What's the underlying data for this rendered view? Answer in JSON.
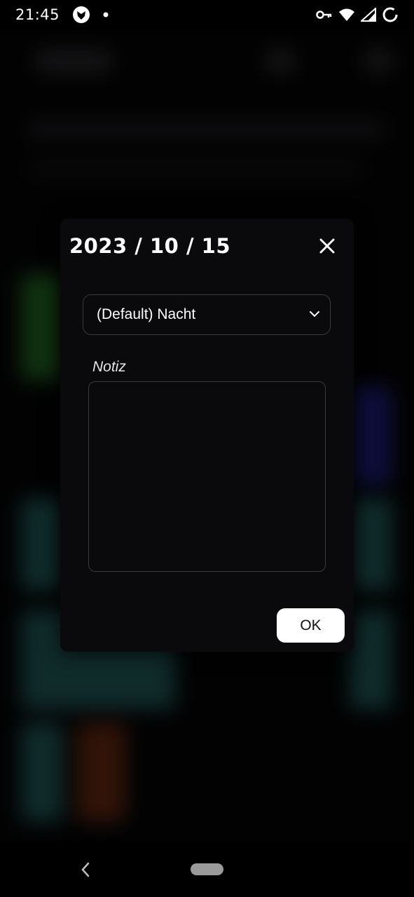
{
  "status_bar": {
    "time": "21:45",
    "icons": [
      "app-notification-icon",
      "dot-icon",
      "vpn-key-icon",
      "wifi-icon",
      "signal-icon",
      "battery-saver-icon"
    ]
  },
  "dialog": {
    "title": "2023 / 10 / 15",
    "close_icon": "close-icon",
    "shift_select": {
      "selected": "(Default) Nacht",
      "icon": "chevron-down-icon"
    },
    "note": {
      "label": "Notiz",
      "value": ""
    },
    "ok_label": "OK"
  },
  "nav_bar": {
    "back_icon": "back-chevron-icon",
    "home_icon": "home-pill"
  },
  "colors": {
    "dialog_bg": "#0a0a0c",
    "border": "#3a3a40",
    "ok_bg": "#ffffff",
    "bg_green": "#1f5a1f",
    "bg_teal": "#1d4f4d",
    "bg_blue": "#1a1a6a",
    "bg_orange": "#5a2410"
  }
}
